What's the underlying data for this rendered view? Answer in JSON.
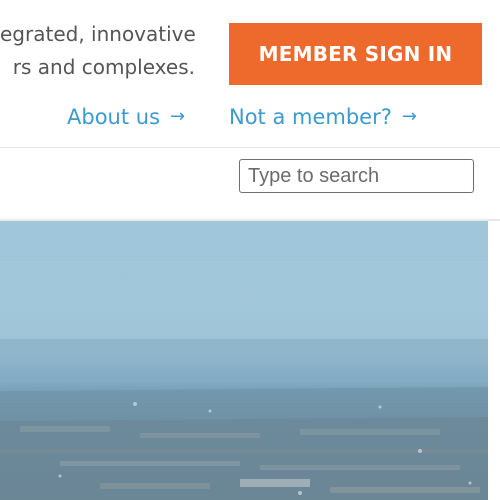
{
  "header": {
    "tagline_line1": "egrated, innovative",
    "tagline_line2": "rs and complexes.",
    "signin_label": "MEMBER SIGN IN",
    "about_label": "About us",
    "not_member_label": "Not a member?",
    "arrow": "→"
  },
  "search": {
    "placeholder": "Type to search",
    "value": ""
  },
  "hero": {
    "alt": "Aerial landscape photo"
  },
  "colors": {
    "accent": "#ed6a2c",
    "link": "#3b9bd1",
    "text": "#555555"
  }
}
